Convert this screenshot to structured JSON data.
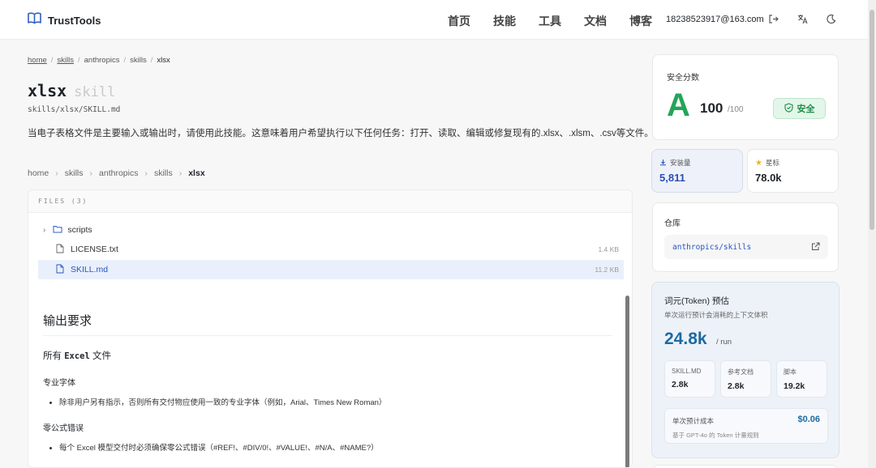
{
  "header": {
    "brand": "TrustTools",
    "nav": [
      "首页",
      "技能",
      "工具",
      "文档",
      "博客"
    ],
    "user_email": "18238523917@163.com"
  },
  "breadcrumb_top": {
    "items": [
      "home",
      "skills",
      "anthropics",
      "skills",
      "xlsx"
    ]
  },
  "skill": {
    "name": "xlsx",
    "kind": "skill",
    "path": "skills/xlsx/SKILL.md",
    "description": "当电子表格文件是主要输入或输出时，请使用此技能。这意味着用户希望执行以下任何任务：打开、读取、编辑或修复现有的.xlsx、.xlsm、.csv等文件。"
  },
  "breadcrumb_files": {
    "items": [
      "home",
      "skills",
      "anthropics",
      "skills",
      "xlsx"
    ]
  },
  "files": {
    "header": "FILES (3)",
    "items": [
      {
        "name": "scripts",
        "type": "folder",
        "size": ""
      },
      {
        "name": "LICENSE.txt",
        "type": "file",
        "size": "1.4 KB"
      },
      {
        "name": "SKILL.md",
        "type": "file",
        "size": "11.2 KB"
      }
    ],
    "selected": "SKILL.md"
  },
  "doc": {
    "h2": "输出要求",
    "h3_prefix": "所有",
    "h3_code": "Excel",
    "h3_suffix": "文件",
    "sec1_title": "专业字体",
    "sec1_item": "除非用户另有指示，否则所有交付物应使用一致的专业字体（例如，Arial、Times New Roman）",
    "sec2_title": "零公式错误",
    "sec2_item": "每个 Excel 模型交付时必须确保零公式错误（#REF!、#DIV/0!、#VALUE!、#N/A、#NAME?）"
  },
  "security": {
    "label": "安全分数",
    "grade": "A",
    "score": "100",
    "max": "/100",
    "badge": "安全",
    "accent": "#22a559"
  },
  "stats": {
    "installs_label": "安装量",
    "installs": "5,811",
    "stars_label": "星标",
    "stars": "78.0k"
  },
  "repo": {
    "label": "仓库",
    "link": "anthropics/skills"
  },
  "tokens": {
    "title": "词元(Token) 预估",
    "subtitle": "单次运行预计会消耗的上下文体积",
    "total": "24.8k",
    "unit": "/ run",
    "breakdown": [
      {
        "label": "SKILL.MD",
        "value": "2.8k"
      },
      {
        "label": "参考文档",
        "value": "2.8k"
      },
      {
        "label": "脚本",
        "value": "19.2k"
      }
    ],
    "cost_label": "单次预计成本",
    "cost_value": "$0.06",
    "cost_note": "基于 GPT-4o 的 Token 计量规则"
  }
}
